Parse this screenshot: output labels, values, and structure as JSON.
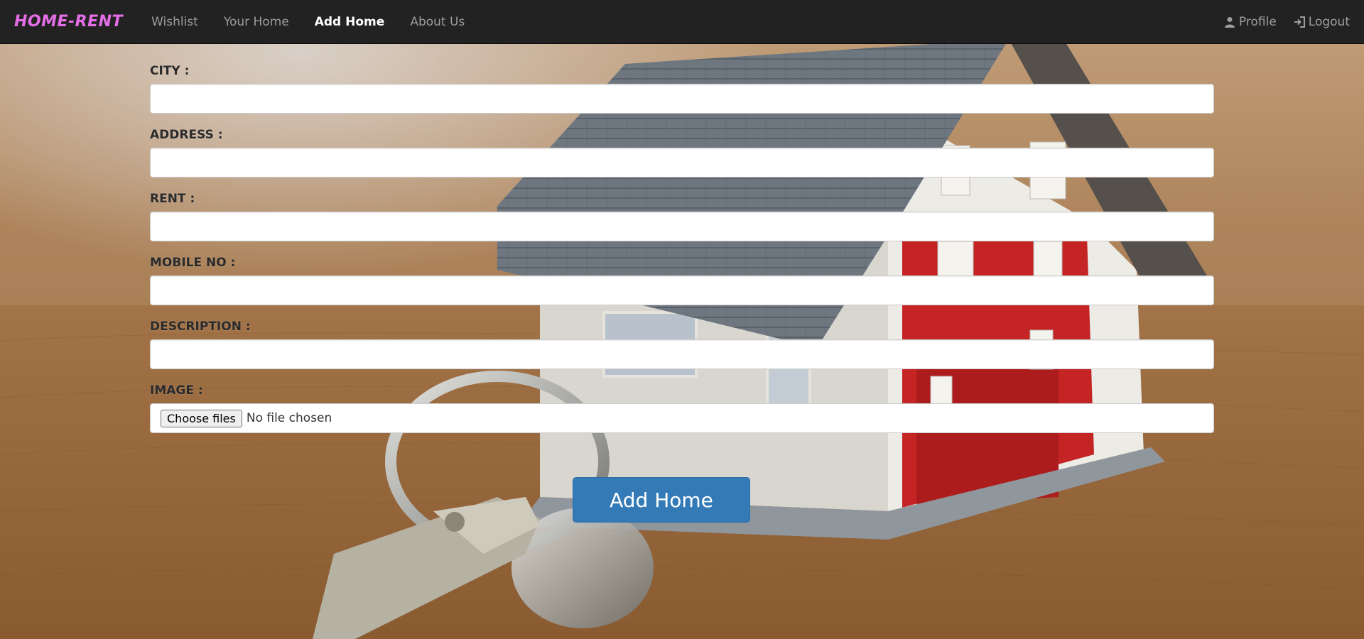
{
  "brand": "HOME-RENT",
  "nav": {
    "items": [
      {
        "label": "Wishlist"
      },
      {
        "label": "Your Home"
      },
      {
        "label": "Add Home"
      },
      {
        "label": "About Us"
      }
    ],
    "active": "Add Home",
    "profile_label": "Profile",
    "profile_icon": "user-icon",
    "logout_label": "Logout",
    "logout_icon": "log-in-icon"
  },
  "form": {
    "city_label": "CITY :",
    "city_value": "",
    "address_label": "ADDRESS :",
    "address_value": "",
    "rent_label": "RENT :",
    "rent_value": "",
    "mobile_label": "MOBILE NO :",
    "mobile_value": "",
    "description_label": "DESCRIPTION :",
    "description_value": "",
    "image_label": "IMAGE :",
    "file_button_label": "Choose files",
    "file_status": "No file chosen",
    "submit_label": "Add Home"
  },
  "colors": {
    "navbar_bg": "#222222",
    "brand": "#e46ee6",
    "primary_button": "#337ab7"
  },
  "background": "house-with-keys-photo"
}
